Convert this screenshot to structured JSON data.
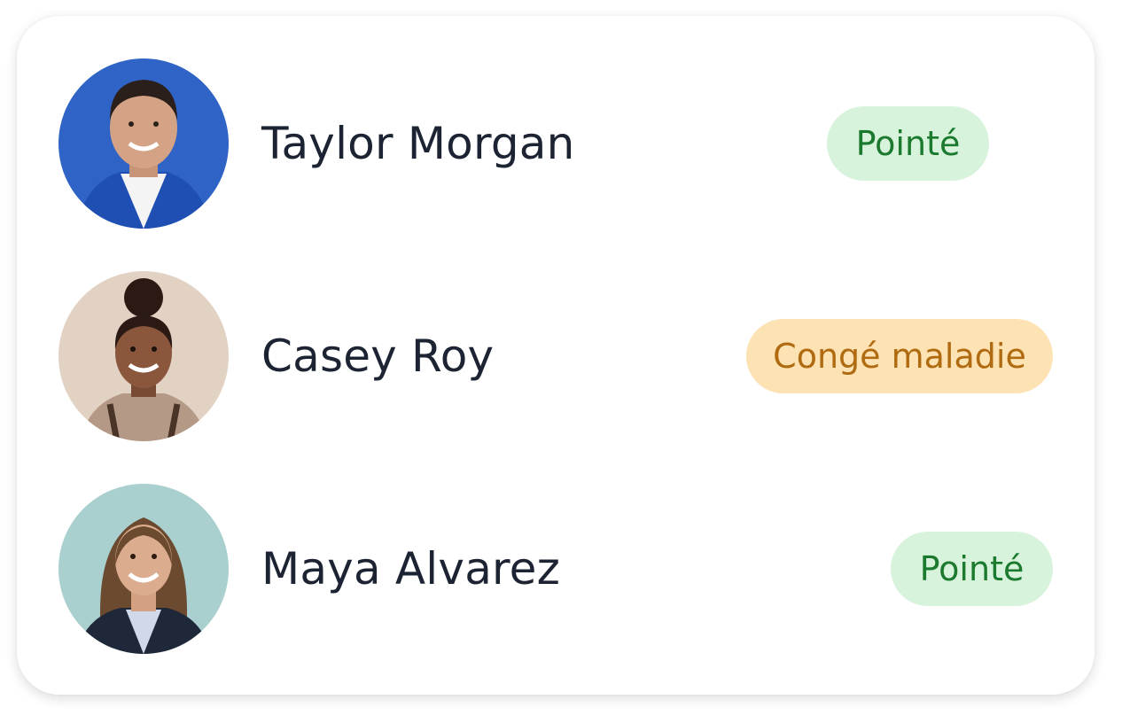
{
  "employees": [
    {
      "name": "Taylor Morgan",
      "status": "Pointé",
      "status_type": "ok"
    },
    {
      "name": "Casey Roy",
      "status": "Congé maladie",
      "status_type": "warn"
    },
    {
      "name": "Maya Alvarez",
      "status": "Pointé",
      "status_type": "ok"
    }
  ],
  "colors": {
    "ok_bg": "#d8f3dc",
    "ok_text": "#1b7a2e",
    "warn_bg": "#fde2b3",
    "warn_text": "#b06a10",
    "name_text": "#1c2333"
  },
  "icons": {
    "avatar_1": "person-photo",
    "avatar_2": "person-photo",
    "avatar_3": "person-photo"
  }
}
